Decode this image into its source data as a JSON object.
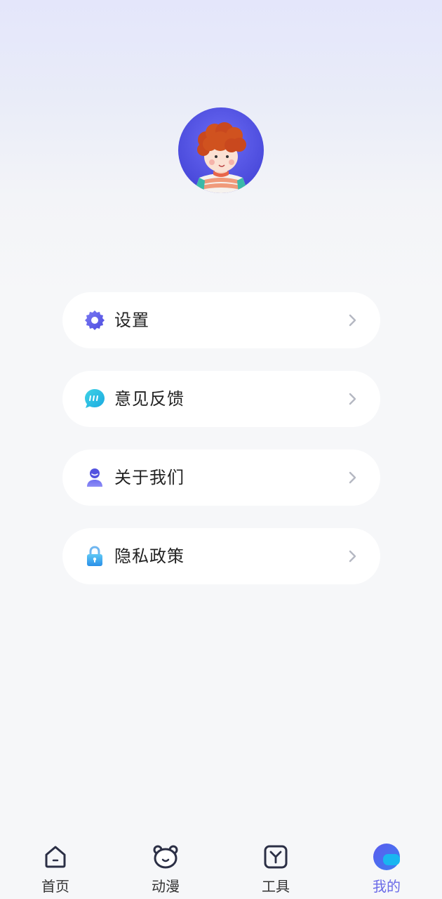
{
  "profile": {
    "avatar": "avatar-image"
  },
  "menu": [
    {
      "label": "设置",
      "icon": "gear-icon"
    },
    {
      "label": "意见反馈",
      "icon": "chat-bubble-icon"
    },
    {
      "label": "关于我们",
      "icon": "user-icon"
    },
    {
      "label": "隐私政策",
      "icon": "lock-icon"
    }
  ],
  "tabs": [
    {
      "label": "首页",
      "icon": "home-icon",
      "active": false
    },
    {
      "label": "动漫",
      "icon": "bear-icon",
      "active": false
    },
    {
      "label": "工具",
      "icon": "tool-icon",
      "active": false
    },
    {
      "label": "我的",
      "icon": "profile-icon",
      "active": true
    }
  ],
  "colors": {
    "accent": "#6a6ae8",
    "text": "#222222",
    "tab_text": "#333333",
    "chevron": "#b5b8c2"
  }
}
